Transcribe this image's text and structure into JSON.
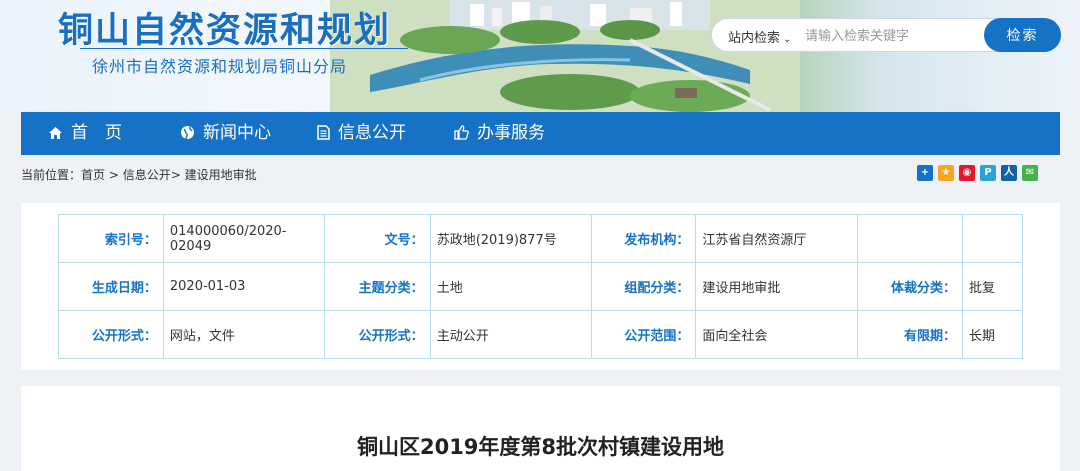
{
  "header": {
    "site_title": "铜山自然资源和规划",
    "site_subtitle": "徐州市自然资源和规划局铜山分局"
  },
  "search": {
    "scope": "站内检索",
    "placeholder": "请输入检索关键字",
    "button": "检索"
  },
  "nav": {
    "items": [
      {
        "label": "首　页",
        "icon": "home-icon"
      },
      {
        "label": "新闻中心",
        "icon": "globe-icon"
      },
      {
        "label": "信息公开",
        "icon": "document-icon"
      },
      {
        "label": "办事服务",
        "icon": "thumbs-up-icon"
      }
    ]
  },
  "breadcrumb": {
    "prefix": "当前位置：",
    "home": "首页",
    "sep1": " > ",
    "section": "信息公开",
    "sep2": "> ",
    "current": "建设用地审批"
  },
  "share_icons": [
    {
      "name": "share-plus-icon",
      "color": "#1672c6",
      "glyph": "+"
    },
    {
      "name": "qzone-icon",
      "color": "#f5a623",
      "glyph": "★"
    },
    {
      "name": "weibo-icon",
      "color": "#e6162d",
      "glyph": "微"
    },
    {
      "name": "tencent-weibo-icon",
      "color": "#2aa3d8",
      "glyph": "P"
    },
    {
      "name": "renren-icon",
      "color": "#1160ab",
      "glyph": "人"
    },
    {
      "name": "wechat-icon",
      "color": "#44b549",
      "glyph": "微"
    }
  ],
  "meta": {
    "rows": [
      [
        {
          "label": "索引号：",
          "value": "014000060/2020-02049"
        },
        {
          "label": "文号：",
          "value": "苏政地(2019)877号"
        },
        {
          "label": "发布机构：",
          "value": "江苏省自然资源厅"
        },
        {
          "label": "",
          "value": ""
        }
      ],
      [
        {
          "label": "生成日期：",
          "value": "2020-01-03"
        },
        {
          "label": "主题分类：",
          "value": "土地"
        },
        {
          "label": "组配分类：",
          "value": "建设用地审批"
        },
        {
          "label": "体裁分类：",
          "value": "批复"
        }
      ],
      [
        {
          "label": "公开形式：",
          "value": "网站，文件"
        },
        {
          "label": "公开形式：",
          "value": "主动公开"
        },
        {
          "label": "公开范围：",
          "value": "面向全社会"
        },
        {
          "label": "有限期：",
          "value": "长期"
        }
      ]
    ]
  },
  "article": {
    "title": "铜山区2019年度第8批次村镇建设用地"
  },
  "colors": {
    "primary": "#1672c6",
    "table_border": "#b7dcf0",
    "page_bg": "#eef1f5"
  }
}
